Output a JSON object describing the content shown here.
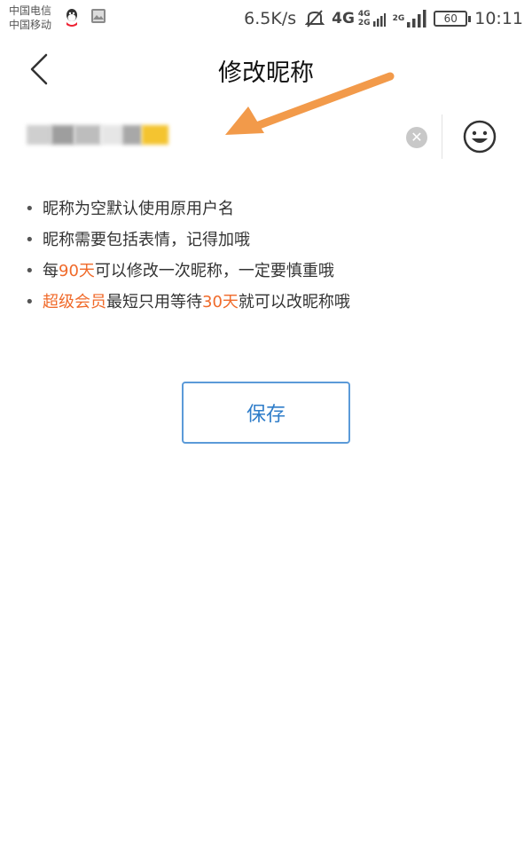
{
  "status_bar": {
    "carrier1": "中国电信",
    "carrier2": "中国移动",
    "speed": "6.5K/s",
    "net_main": "4G",
    "net_small_top": "4G",
    "net_small_bottom": "2G",
    "net_extra": "2G",
    "battery": "60",
    "time": "10:11",
    "icons": [
      "qq-icon",
      "gallery-icon",
      "mute-icon",
      "signal-icon",
      "battery-icon"
    ]
  },
  "nav": {
    "title": "修改昵称",
    "back_icon": "chevron-left-icon"
  },
  "input": {
    "value": "",
    "clear_icon": "clear-icon",
    "emoji_icon": "smiley-icon"
  },
  "tips": [
    {
      "parts": [
        "昵称为空默认使用原用户名"
      ]
    },
    {
      "parts": [
        "昵称需要包括表情，记得加哦"
      ]
    },
    {
      "pre": "每",
      "hl": "90天",
      "post": "可以修改一次昵称，一定要慎重哦"
    },
    {
      "hl1": "超级会员",
      "mid": "最短只用等待",
      "hl2": "30天",
      "post": "就可以改昵称哦"
    }
  ],
  "save_label": "保存",
  "colors": {
    "accent": "#2f7dc9",
    "highlight": "#f06a2a",
    "arrow": "#f29a4a"
  }
}
